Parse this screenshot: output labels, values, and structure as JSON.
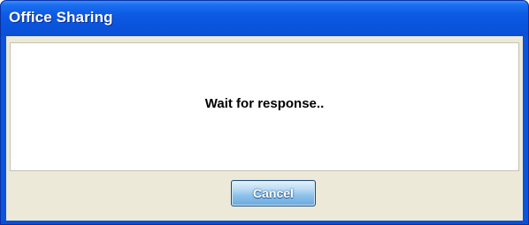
{
  "window": {
    "title": "Office Sharing"
  },
  "dialog": {
    "message": "Wait for response..",
    "cancel_label": "Cancel"
  },
  "colors": {
    "title_bar": "#0a54dc",
    "client_background": "#ece9d8",
    "button_face": "#8dc1ea"
  }
}
